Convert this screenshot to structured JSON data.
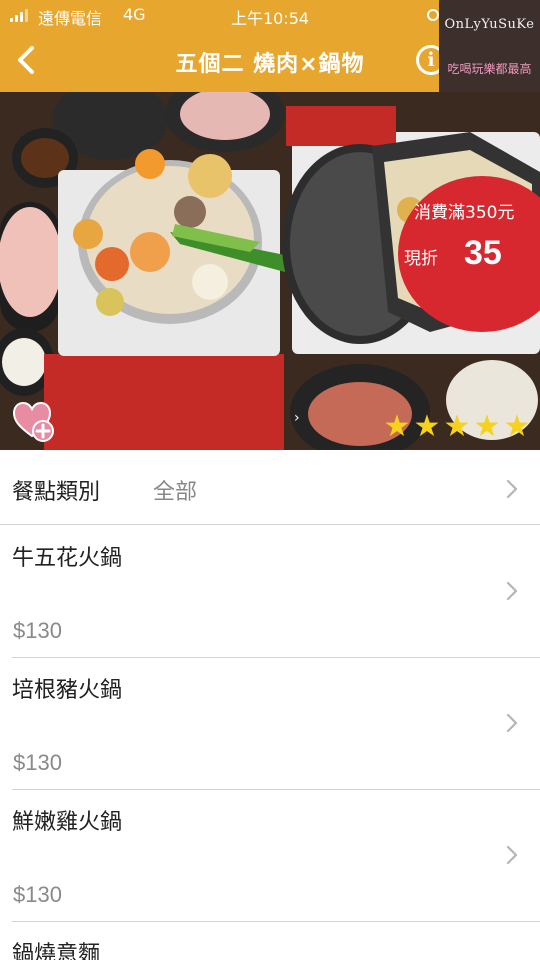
{
  "status_bar": {
    "carrier": "遠傳電信",
    "network": "4G",
    "time": "上午10:54"
  },
  "nav": {
    "title": "五個二 燒肉×鍋物",
    "back_icon": "chevron-left-icon",
    "info_icon": "info-icon",
    "info_glyph": "i"
  },
  "watermark": {
    "line1": "OnLyYuSuKe",
    "line2": "吃喝玩樂都最高"
  },
  "promo": {
    "line1": "消費滿350元",
    "discount_label": "現折",
    "discount_value": "35"
  },
  "rating": {
    "stars": 5,
    "star_glyph": "★"
  },
  "category": {
    "label": "餐點類別",
    "value": "全部"
  },
  "menu_items": [
    {
      "name": "牛五花火鍋",
      "price": "$130"
    },
    {
      "name": "培根豬火鍋",
      "price": "$130"
    },
    {
      "name": "鮮嫩雞火鍋",
      "price": "$130"
    },
    {
      "name": "鍋燒意麵",
      "price": ""
    }
  ],
  "colors": {
    "accent": "#e7a62e",
    "promo_red": "#d8282f",
    "star_yellow": "#f6d21c",
    "fav_pink": "#e88ca3"
  }
}
